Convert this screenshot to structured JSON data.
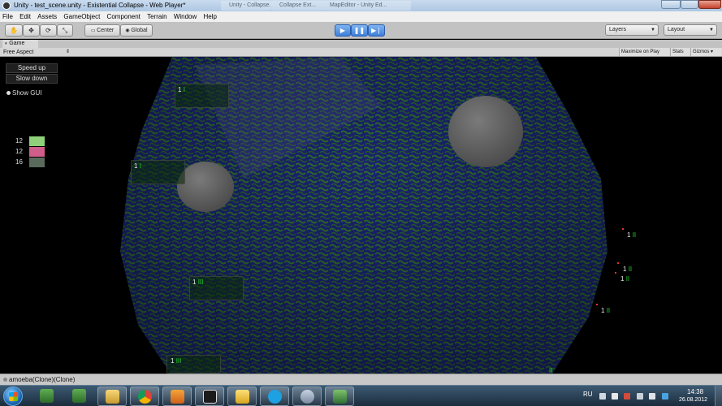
{
  "window": {
    "title": "Unity - test_scene.unity - Existential Collapse - Web Player*",
    "background_tabs": [
      "Unity - Collapse...",
      "Collapse Ext...",
      "MapEditor - Unity Ed..."
    ]
  },
  "menu": [
    "File",
    "Edit",
    "Assets",
    "GameObject",
    "Component",
    "Terrain",
    "Window",
    "Help"
  ],
  "toolbar": {
    "pivot_label": "Center",
    "space_label": "Global",
    "layers_label": "Layers",
    "layout_label": "Layout"
  },
  "game_panel": {
    "tab_label": "Game",
    "aspect_label": "Free Aspect",
    "maximize_label": "Maximize on Play",
    "stats_label": "Stats",
    "gizmos_label": "Gizmos"
  },
  "gui": {
    "speed_up": "Speed up",
    "slow_down": "Slow down",
    "show_gui": "Show GUI",
    "legend": [
      {
        "count": "12",
        "color": "#8fd17a"
      },
      {
        "count": "12",
        "color": "#cf5e8a"
      },
      {
        "count": "16",
        "color": "#5a6b5e"
      }
    ]
  },
  "cells": [
    {
      "number": "1",
      "marks": "I"
    },
    {
      "number": "1",
      "marks": "I"
    },
    {
      "number": "1",
      "marks": "III"
    },
    {
      "number": "1",
      "marks": "III"
    },
    {
      "number": "1",
      "marks": "II"
    },
    {
      "number": "1",
      "marks": "II"
    },
    {
      "number": "1",
      "marks": "II"
    },
    {
      "number": "1",
      "marks": "II"
    },
    {
      "number": "",
      "marks": "II"
    }
  ],
  "status": {
    "message": "amoeba(Clone)(Clone)"
  },
  "taskbar": {
    "language": "RU",
    "time": "14:38",
    "date": "26.08.2012"
  },
  "colors": {
    "planet_green": "#2c6b2a",
    "planet_blue": "#1a2470",
    "play_blue": "#3f7fd9",
    "mark_green": "#22d12a"
  }
}
